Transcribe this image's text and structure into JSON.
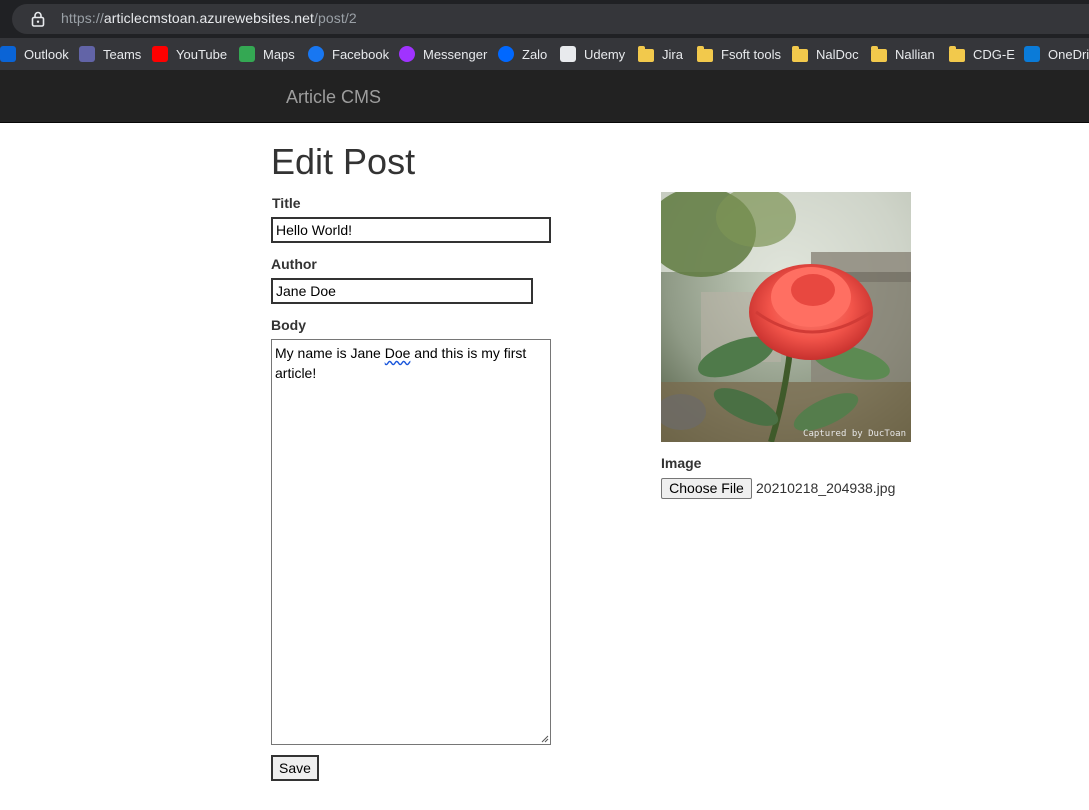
{
  "browser": {
    "url_scheme": "https://",
    "url_host": "articlecmstoan.azurewebsites.net",
    "url_path": "/post/2",
    "bookmarks": [
      {
        "label": "Outlook",
        "icon": "outlook-icon",
        "color": "#0a64d6"
      },
      {
        "label": "Teams",
        "icon": "teams-icon",
        "color": "#6264a7"
      },
      {
        "label": "YouTube",
        "icon": "youtube-icon",
        "color": "#ff0000"
      },
      {
        "label": "Maps",
        "icon": "maps-pin-icon",
        "color": "#34a853"
      },
      {
        "label": "Facebook",
        "icon": "facebook-icon",
        "color": "#1877f2"
      },
      {
        "label": "Messenger",
        "icon": "messenger-icon",
        "color": "#a033ff"
      },
      {
        "label": "Zalo",
        "icon": "zalo-icon",
        "color": "#0068ff"
      },
      {
        "label": "Udemy",
        "icon": "udemy-icon",
        "color": "#e8eaed"
      },
      {
        "label": "Jira",
        "icon": "folder-icon",
        "color": "#f2c94c"
      },
      {
        "label": "Fsoft tools",
        "icon": "folder-icon",
        "color": "#f2c94c"
      },
      {
        "label": "NalDoc",
        "icon": "folder-icon",
        "color": "#f2c94c"
      },
      {
        "label": "Nallian",
        "icon": "folder-icon",
        "color": "#f2c94c"
      },
      {
        "label": "CDG-E",
        "icon": "folder-icon",
        "color": "#f2c94c"
      },
      {
        "label": "OneDrive",
        "icon": "onedrive-icon",
        "color": "#0a7bd8"
      }
    ]
  },
  "navbar": {
    "brand": "Article CMS"
  },
  "form": {
    "heading": "Edit Post",
    "title_label": "Title",
    "title_value": "Hello World!",
    "author_label": "Author",
    "author_value": "Jane Doe",
    "body_label": "Body",
    "body_before": "My name is Jane ",
    "body_misspelled": "Doe",
    "body_after": " and this is my first article!",
    "save_label": "Save"
  },
  "image_panel": {
    "watermark": "Captured by DucToan",
    "image_label": "Image",
    "choose_file_label": "Choose File",
    "file_name": "20210218_204938.jpg"
  }
}
